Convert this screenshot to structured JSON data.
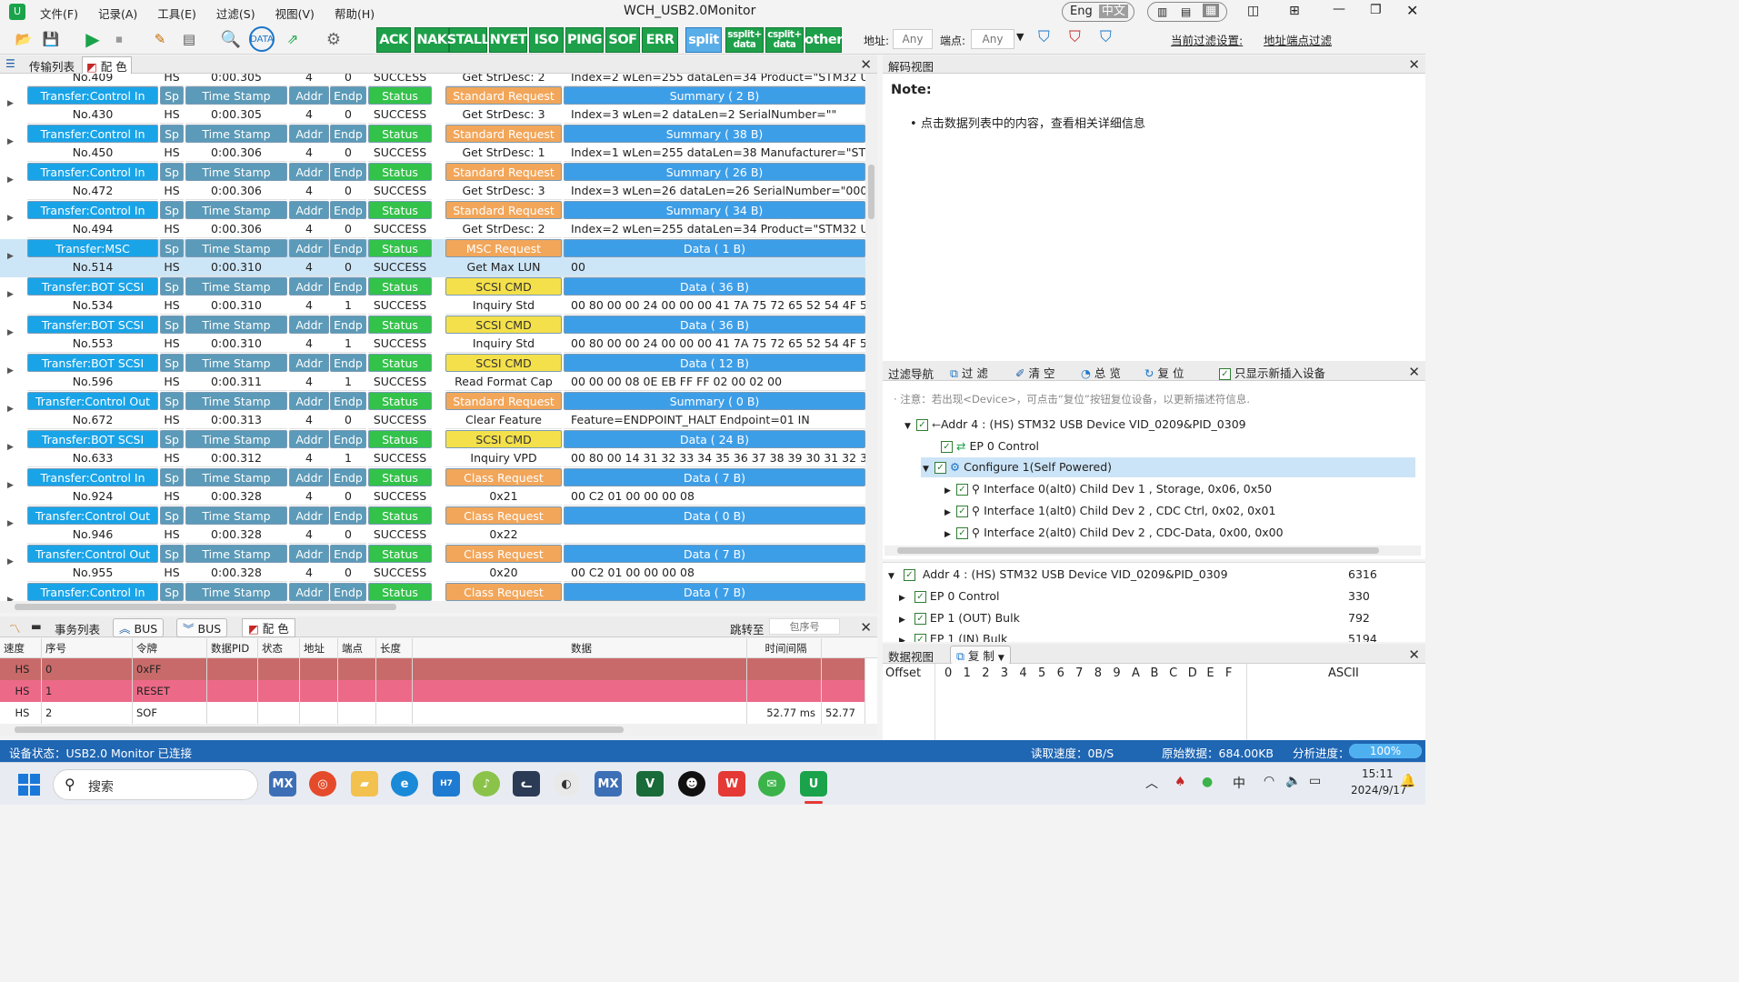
{
  "app": {
    "title": "WCH_USB2.0Monitor",
    "menu": [
      "文件(F)",
      "记录(A)",
      "工具(E)",
      "过滤(S)",
      "视图(V)",
      "帮助(H)"
    ],
    "lang_en": "Eng",
    "lang_zh": "中文"
  },
  "toolbar": {
    "packet_buttons": [
      "ACK",
      "NAK",
      "STALL",
      "NYET",
      "ISO",
      "PING",
      "SOF",
      "ERR",
      "split",
      "ssplit+ data",
      "csplit+ data",
      "other"
    ],
    "addr_label": "地址:",
    "addr_placeholder": "Any",
    "endp_label": "端点:",
    "endp_placeholder": "Any",
    "filter_setting_label": "当前过滤设置:",
    "filter_setting_value": "地址端点过滤",
    "icons": [
      "folder-open-icon",
      "save-icon",
      "play-icon",
      "stop-icon",
      "edit-icon",
      "document-icon",
      "search-icon",
      "data-icon",
      "export-icon",
      "settings-icon"
    ]
  },
  "transfer_panel": {
    "tab_label": "传输列表",
    "color_label": "配 色",
    "partial_top": {
      "no": "No.409",
      "sp": "HS",
      "time": "0:00.305",
      "addr": "4",
      "endp": "0",
      "status": "SUCCESS",
      "req": "Get StrDesc: 2",
      "detail": "Index=2 wLen=255 dataLen=34 Product=\"STM32 USB Devic"
    },
    "rows": [
      {
        "transfer": "Transfer:Control In",
        "no": "No.430",
        "sp": "HS",
        "time": "0:00.305",
        "addr": "4",
        "endp": "0",
        "status": "SUCCESS",
        "req_type": "Standard Request",
        "req_kind": "std",
        "req_sub": "Get StrDesc: 3",
        "sum": "Summary ( 2 B)",
        "detail": "Index=3 wLen=2 dataLen=2 SerialNumber=\"\""
      },
      {
        "transfer": "Transfer:Control In",
        "no": "No.450",
        "sp": "HS",
        "time": "0:00.306",
        "addr": "4",
        "endp": "0",
        "status": "SUCCESS",
        "req_type": "Standard Request",
        "req_kind": "std",
        "req_sub": "Get StrDesc: 1",
        "sum": "Summary ( 38 B)",
        "detail": "Index=1 wLen=255 dataLen=38 Manufacturer=\"STMicroele"
      },
      {
        "transfer": "Transfer:Control In",
        "no": "No.472",
        "sp": "HS",
        "time": "0:00.306",
        "addr": "4",
        "endp": "0",
        "status": "SUCCESS",
        "req_type": "Standard Request",
        "req_kind": "std",
        "req_sub": "Get StrDesc: 3",
        "sum": "Summary ( 26 B)",
        "detail": "Index=3 wLen=26 dataLen=26 SerialNumber=\"0000000000"
      },
      {
        "transfer": "Transfer:Control In",
        "no": "No.494",
        "sp": "HS",
        "time": "0:00.306",
        "addr": "4",
        "endp": "0",
        "status": "SUCCESS",
        "req_type": "Standard Request",
        "req_kind": "std",
        "req_sub": "Get StrDesc: 2",
        "sum": "Summary ( 34 B)",
        "detail": "Index=2 wLen=255 dataLen=34 Product=\"STM32 USB Devic"
      },
      {
        "transfer": "Transfer:MSC",
        "no": "No.514",
        "sp": "HS",
        "time": "0:00.310",
        "addr": "4",
        "endp": "0",
        "status": "SUCCESS",
        "req_type": "MSC Request",
        "req_kind": "std",
        "req_sub": "Get Max LUN",
        "sum": "Data ( 1 B)",
        "detail": "00",
        "selected": true
      },
      {
        "transfer": "Transfer:BOT SCSI",
        "no": "No.534",
        "sp": "HS",
        "time": "0:00.310",
        "addr": "4",
        "endp": "1",
        "status": "SUCCESS",
        "req_type": "SCSI CMD",
        "req_kind": "scsi",
        "req_sub": "Inquiry Std",
        "sum": "Data ( 36 B)",
        "detail": "00 80 00 00 24 00 00 00 41 7A 75 72 65 52 54 4F 55 53 42 58 20 7"
      },
      {
        "transfer": "Transfer:BOT SCSI",
        "no": "No.553",
        "sp": "HS",
        "time": "0:00.310",
        "addr": "4",
        "endp": "1",
        "status": "SUCCESS",
        "req_type": "SCSI CMD",
        "req_kind": "scsi",
        "req_sub": "Inquiry Std",
        "sum": "Data ( 36 B)",
        "detail": "00 80 00 00 24 00 00 00 41 7A 75 72 65 52 54 4F 55 53 42 58 20 7"
      },
      {
        "transfer": "Transfer:BOT SCSI",
        "no": "No.596",
        "sp": "HS",
        "time": "0:00.311",
        "addr": "4",
        "endp": "1",
        "status": "SUCCESS",
        "req_type": "SCSI CMD",
        "req_kind": "scsi",
        "req_sub": "Read Format Cap",
        "sum": "Data ( 12 B)",
        "detail": "00 00 00 08 0E EB FF FF 02 00 02 00"
      },
      {
        "transfer": "Transfer:Control Out",
        "no": "No.672",
        "sp": "HS",
        "time": "0:00.313",
        "addr": "4",
        "endp": "0",
        "status": "SUCCESS",
        "req_type": "Standard Request",
        "req_kind": "std",
        "req_sub": "Clear Feature",
        "sum": "Summary ( 0 B)",
        "detail": "Feature=ENDPOINT_HALT Endpoint=01 IN"
      },
      {
        "transfer": "Transfer:BOT SCSI",
        "no": "No.633",
        "sp": "HS",
        "time": "0:00.312",
        "addr": "4",
        "endp": "1",
        "status": "SUCCESS",
        "req_type": "SCSI CMD",
        "req_kind": "scsi",
        "req_sub": "Inquiry VPD",
        "sum": "Data ( 24 B)",
        "detail": "00 80 00 14 31 32 33 34 35 36 37 38 39 30 31 32 33 34 35 36 37 3"
      },
      {
        "transfer": "Transfer:Control In",
        "no": "No.924",
        "sp": "HS",
        "time": "0:00.328",
        "addr": "4",
        "endp": "0",
        "status": "SUCCESS",
        "req_type": "Class Request",
        "req_kind": "cls",
        "req_sub": "0x21",
        "sum": "Data ( 7 B)",
        "detail": "00 C2 01 00 00 00 08"
      },
      {
        "transfer": "Transfer:Control Out",
        "no": "No.946",
        "sp": "HS",
        "time": "0:00.328",
        "addr": "4",
        "endp": "0",
        "status": "SUCCESS",
        "req_type": "Class Request",
        "req_kind": "cls",
        "req_sub": "0x22",
        "sum": "Data ( 0 B)",
        "detail": ""
      },
      {
        "transfer": "Transfer:Control Out",
        "no": "No.955",
        "sp": "HS",
        "time": "0:00.328",
        "addr": "4",
        "endp": "0",
        "status": "SUCCESS",
        "req_type": "Class Request",
        "req_kind": "cls",
        "req_sub": "0x20",
        "sum": "Data ( 7 B)",
        "detail": "00 C2 01 00 00 00 08"
      },
      {
        "transfer": "Transfer:Control In",
        "no": "",
        "sp": "",
        "time": "",
        "addr": "",
        "endp": "",
        "status": "",
        "req_type": "Class Request",
        "req_kind": "cls",
        "req_sub": "",
        "sum": "Data ( 7 B)",
        "detail": ""
      }
    ],
    "col_labels": {
      "sp": "Sp",
      "time": "Time Stamp",
      "addr": "Addr",
      "endp": "Endp",
      "status": "Status"
    }
  },
  "decode_panel": {
    "title": "解码视图",
    "note": "Note:",
    "bullet": "点击数据列表中的内容，查看相关详细信息"
  },
  "filter_nav": {
    "title": "过滤导航",
    "filter": "过 滤",
    "clear": "清 空",
    "overview": "总 览",
    "reset": "复 位",
    "only_new": "只显示新插入设备",
    "hint": "· 注意：若出现<Device>，可点击“复位”按钮复位设备，以更新描述符信息.",
    "tree": [
      "Addr 4 : (HS) STM32 USB Device VID_0209&PID_0309",
      "EP 0 Control",
      "Configure 1(Self Powered)",
      "Interface 0(alt0) Child Dev 1 , Storage, 0x06, 0x50",
      "Interface 1(alt0) Child Dev 2 , CDC Ctrl, 0x02, 0x01",
      "Interface 2(alt0) Child Dev 2 , CDC-Data, 0x00, 0x00"
    ],
    "stats": [
      {
        "name": "Addr 4 : (HS) STM32 USB Device VID_0209&PID_0309",
        "count": "6316"
      },
      {
        "name": "EP 0 Control",
        "count": "330"
      },
      {
        "name": "EP 1 (OUT) Bulk",
        "count": "792"
      },
      {
        "name": "EP 1 (IN) Bulk",
        "count": "5194"
      }
    ]
  },
  "data_view": {
    "title": "数据视图",
    "copy": "复 制",
    "offset": "Offset",
    "hex_cols": [
      "0",
      "1",
      "2",
      "3",
      "4",
      "5",
      "6",
      "7",
      "8",
      "9",
      "A",
      "B",
      "C",
      "D",
      "E",
      "F"
    ],
    "ascii": "ASCII"
  },
  "events_panel": {
    "tab": "事务列表",
    "bus1": "BUS",
    "bus2": "BUS",
    "color": "配 色",
    "jump": "跳转至",
    "jump_placeholder": "包序号",
    "columns": [
      "速度",
      "序号",
      "令牌",
      "数据PID",
      "状态",
      "地址",
      "端点",
      "长度",
      "数据",
      "时间间隔"
    ],
    "rows": [
      {
        "speed": "HS",
        "seq": "0",
        "token": "0xFF",
        "interval": "",
        "extra": "",
        "style": "err1"
      },
      {
        "speed": "HS",
        "seq": "1",
        "token": "RESET",
        "interval": "",
        "extra": "",
        "style": "err2"
      },
      {
        "speed": "HS",
        "seq": "2",
        "token": "SOF",
        "interval": "52.77 ms",
        "extra": "52.77",
        "style": "normal"
      }
    ]
  },
  "status_bar": {
    "device": "设备状态：USB2.0 Monitor 已连接",
    "read_speed": "读取速度：0B/S",
    "raw_data": "原始数据：684.00KB",
    "progress_label": "分析进度：",
    "progress": "100%",
    "progress_value": 1.0
  },
  "taskbar": {
    "search": "搜索",
    "ime": "中",
    "time": "15:11",
    "date": "2024/9/17"
  }
}
